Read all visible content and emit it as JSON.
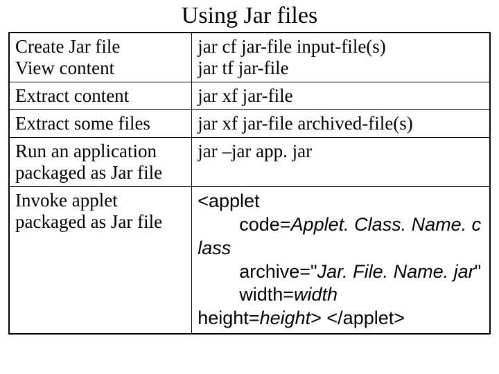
{
  "title": "Using Jar files",
  "rows": [
    {
      "left": "Create Jar file\nView content",
      "right": "jar cf jar-file input-file(s)\njar tf jar-file"
    },
    {
      "left": "Extract content",
      "right": "jar xf jar-file"
    },
    {
      "left": "Extract some files",
      "right": "jar xf jar-file archived-file(s)"
    },
    {
      "left": "Run an application packaged as Jar file",
      "right": "jar –jar app. jar"
    },
    {
      "left": "Invoke applet packaged as Jar file",
      "right_html": "applet_block"
    }
  ],
  "applet": {
    "line1": "<applet",
    "line2a": "code=",
    "line2b": "Applet. Class. Name. c",
    "line3": "lass",
    "line4a": "archive=\"",
    "line4b": "Jar. File. Name. jar",
    "line4c": "\"",
    "line5a": "width=",
    "line5b": "width",
    "line6a": "height=",
    "line6b": "height",
    "line6c": "> </applet>"
  }
}
